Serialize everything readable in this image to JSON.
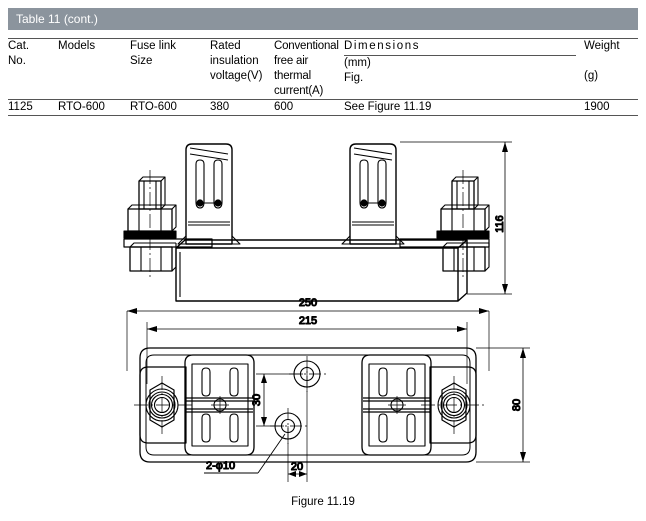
{
  "table": {
    "title": "Table 11 (cont.)",
    "title_bar_color": "#8b949d",
    "columns": [
      {
        "key": "cat",
        "header_lines": [
          "Cat.",
          "No."
        ]
      },
      {
        "key": "mod",
        "header_lines": [
          "Models"
        ]
      },
      {
        "key": "fuse",
        "header_lines": [
          "Fuse link",
          "Size"
        ]
      },
      {
        "key": "rated",
        "header_lines": [
          "Rated",
          "insulation",
          "voltage(V)"
        ]
      },
      {
        "key": "conv",
        "header_lines": [
          "Conventional",
          "free air thermal",
          "current(A)"
        ]
      },
      {
        "key": "dim",
        "header_lines": [
          "Dimensions",
          "(mm)",
          "Fig."
        ]
      },
      {
        "key": "wt",
        "header_lines": [
          "Weight",
          "(g)"
        ]
      }
    ],
    "headers": {
      "cat_line1": "Cat.",
      "cat_line2": "No.",
      "models": "Models",
      "fuse_line1": "Fuse link",
      "fuse_line2": "Size",
      "rated_line1": "Rated",
      "rated_line2": "insulation",
      "rated_line3": "voltage(V)",
      "conv_line1": "Conventional",
      "conv_line2": "free air thermal",
      "conv_line3": "current(A)",
      "dim_line1": "Dimensions",
      "dim_line2": "(mm)",
      "dim_line3": "Fig.",
      "weight_line1": "Weight",
      "weight_line2": "(g)"
    },
    "rows": [
      {
        "cat": "1125",
        "models": "RTO-600",
        "fuse": "RTO-600",
        "rated": "380",
        "conv": "600",
        "dim": "See Figure 11.19",
        "weight": "1900"
      }
    ]
  },
  "figure": {
    "caption": "Figure 11.19",
    "dimensions": {
      "height_116": "116",
      "overall_250": "250",
      "mount_215": "215",
      "width_80": "80",
      "hole_pitch_30": "30",
      "hole_offset_20": "20",
      "hole_spec": "2-φ10"
    }
  }
}
